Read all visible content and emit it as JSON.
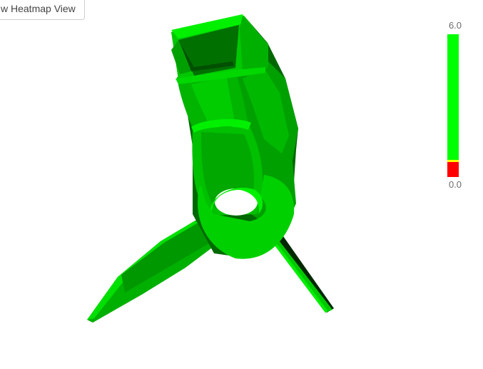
{
  "toolbar": {
    "heatmap_button_label": "w Heatmap View"
  },
  "legend": {
    "max_label": "6.0",
    "min_label": "0.0",
    "colors": {
      "high": "#00ff00",
      "threshold": "#ffff00",
      "low": "#ff0000"
    }
  },
  "model": {
    "icon": "3d-propeller-mesh",
    "colors": {
      "bright": "#00dd00",
      "mid": "#00b400",
      "dark": "#008000",
      "shadow": "#003c00"
    }
  }
}
